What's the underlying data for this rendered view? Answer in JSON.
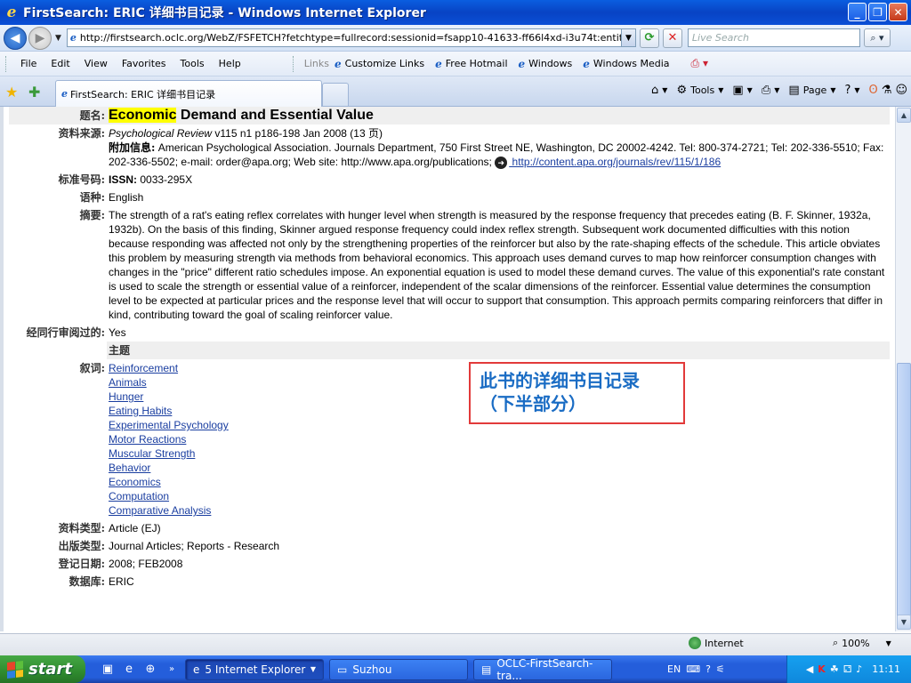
{
  "window": {
    "title": "FirstSearch: ERIC 详细书目记录 - Windows Internet Explorer",
    "btn_min": "_",
    "btn_max": "❐",
    "btn_close": "✕"
  },
  "address": {
    "url": "http://firstsearch.oclc.org/WebZ/FSFETCH?fetchtype=fullrecord:sessionid=fsapp10-41633-ff66l4xd-i3u74t:entitypagenum=",
    "search_placeholder": "Live Search"
  },
  "menu": {
    "items": [
      "File",
      "Edit",
      "View",
      "Favorites",
      "Tools",
      "Help"
    ],
    "links_label": "Links",
    "links": [
      "Customize Links",
      "Free Hotmail",
      "Windows",
      "Windows Media"
    ]
  },
  "tabs": {
    "active_title": "FirstSearch: ERIC 详细书目记录"
  },
  "cmdbar": {
    "tools": "Tools",
    "page": "Page"
  },
  "record": {
    "title_label": "题名:",
    "title_highlight": "Economic",
    "title_rest": " Demand and Essential Value",
    "source_label": "资料来源:",
    "source_journal": "Psychological Review",
    "source_rest": " v115 n1 p186-198 Jan 2008 (13 页)",
    "extra_label": "附加信息:",
    "extra_text": " American Psychological Association. Journals Department, 750 First Street NE, Washington, DC 20002-4242. Tel: 800-374-2721; Tel: 202-336-5510; Fax: 202-336-5502; e-mail: order@apa.org; Web site: http://www.apa.org/publications;",
    "extra_link": " http://content.apa.org/journals/rev/115/1/186",
    "std_label": "标准号码:",
    "issn_label": "ISSN:",
    "issn": " 0033-295X",
    "lang_label": "语种:",
    "lang": "English",
    "abstract_label": "摘要:",
    "abstract": "The strength of a rat's eating reflex correlates with hunger level when strength is measured by the response frequency that precedes eating (B. F. Skinner, 1932a, 1932b). On the basis of this finding, Skinner argued response frequency could index reflex strength. Subsequent work documented difficulties with this notion because responding was affected not only by the strengthening properties of the reinforcer but also by the rate-shaping effects of the schedule. This article obviates this problem by measuring strength via methods from behavioral economics. This approach uses demand curves to map how reinforcer consumption changes with changes in the \"price\" different ratio schedules impose. An exponential equation is used to model these demand curves. The value of this exponential's rate constant is used to scale the strength or essential value of a reinforcer, independent of the scalar dimensions of the reinforcer. Essential value determines the consumption level to be expected at particular prices and the response level that will occur to support that consumption. This approach permits comparing reinforcers that differ in kind, contributing toward the goal of scaling reinforcer value.",
    "peer_label": "经同行审阅过的:",
    "peer": "Yes",
    "subject_head": "主题",
    "desc_label": "叙词:",
    "descriptors": [
      "Reinforcement",
      "Animals",
      "Hunger",
      "Eating Habits",
      "Experimental Psychology",
      "Motor Reactions",
      "Muscular Strength",
      "Behavior",
      "Economics",
      "Computation",
      "Comparative Analysis"
    ],
    "restype_label": "资料类型:",
    "restype": "Article (EJ)",
    "pubtype_label": "出版类型:",
    "pubtype": "Journal Articles; Reports - Research",
    "date_label": "登记日期:",
    "date": "2008; FEB2008",
    "db_label": "数据库:",
    "db": "ERIC"
  },
  "annotation": {
    "line1": "此书的详细书目记录",
    "line2": "（下半部分）"
  },
  "status": {
    "zone": "Internet",
    "zoom": "100%"
  },
  "taskbar": {
    "start": "start",
    "tasks": [
      "5 Internet Explorer",
      "Suzhou",
      "OCLC-FirstSearch-tra..."
    ],
    "lang": "EN",
    "clock": "11:11"
  }
}
